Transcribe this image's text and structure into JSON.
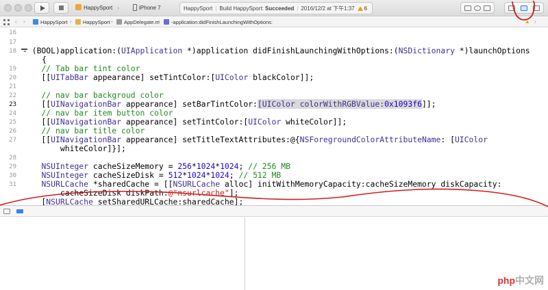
{
  "toolbar": {
    "scheme_app": "HappySport",
    "scheme_device": "iPhone 7",
    "status": {
      "project": "HappySport",
      "build_prefix": "Build HappySport: ",
      "build_result": "Succeeded",
      "timestamp": "2016/12/2 at 下午1:37",
      "warning_count": "6"
    }
  },
  "jumpbar": {
    "crumbs": [
      "HappySport",
      "HappySport",
      "AppDelegate.m",
      "-application:didFinishLaunchingWithOptions:"
    ]
  },
  "gutter": [
    "16",
    "17",
    "18",
    "19",
    "20",
    "21",
    "22",
    "23",
    "24",
    "25",
    "26",
    "27",
    "28",
    "29",
    "30",
    "31"
  ],
  "code": {
    "line18a": "- (BOOL)application:(",
    "line18b": "UIApplication",
    "line18c": " *)application didFinishLaunchingWithOptions:(",
    "line18d": "NSDictionary",
    "line18e": " *)launchOptions",
    "line18f": "{",
    "line19": "    // Tab bar tint color",
    "line20a": "    [[",
    "line20b": "UITabBar",
    "line20c": " appearance] setTintColor:[",
    "line20d": "UIColor",
    "line20e": " blackColor]];",
    "line22": "    // nav bar backgroud color",
    "line23a": "    [[",
    "line23b": "UINavigationBar",
    "line23c": " appearance] setBarTintColor:",
    "line23d": "[UIColor colorWithRGBValue:",
    "line23e": "0x1093f6",
    "line23f": "]];",
    "line24": "    // nav bar item button color",
    "line25a": "    [[",
    "line25b": "UINavigationBar",
    "line25c": " appearance] setTintColor:[",
    "line25d": "UIColor",
    "line25e": " whiteColor]];",
    "line26": "    // nav bar title color",
    "line27a": "    [[",
    "line27b": "UINavigationBar",
    "line27c": " appearance] setTitleTextAttributes:@{",
    "line27d": "NSForegroundColorAttributeName",
    "line27e": ": [",
    "line27f": "UIColor",
    "line27g": "        whiteColor]}];",
    "line29a": "    ",
    "line29b": "NSUInteger",
    "line29c": " cacheSizeMemory = ",
    "line29d": "256",
    "line29e": "*",
    "line29f": "1024",
    "line29g": "*",
    "line29h": "1024",
    "line29i": "; ",
    "line29j": "// 256 MB",
    "line30a": "    ",
    "line30b": "NSUInteger",
    "line30c": " cacheSizeDisk = ",
    "line30d": "512",
    "line30e": "*",
    "line30f": "1024",
    "line30g": "*",
    "line30h": "1024",
    "line30i": "; ",
    "line30j": "// 512 MB",
    "line31a": "    ",
    "line31b": "NSURLCache",
    "line31c": " *sharedCache = [[",
    "line31d": "NSURLCache",
    "line31e": " alloc] initWithMemoryCapacity:cacheSizeMemory diskCapacity:",
    "line31f": "        cacheSizeDisk diskPath:",
    "line31g": "@\"nsurlcache\"",
    "line31h": "];",
    "line32a": "    [",
    "line32b": "NSURLCache",
    "line32c": " setSharedURLCache:sharedCache];"
  },
  "watermark": {
    "a": "php",
    "b": "中文网"
  },
  "colors": {
    "accent": "#2c7fe0",
    "annotation": "#d21a1a",
    "comment": "#1f8a1f",
    "class": "#3d2f94",
    "number": "#1c00cf",
    "string": "#c41a16"
  }
}
